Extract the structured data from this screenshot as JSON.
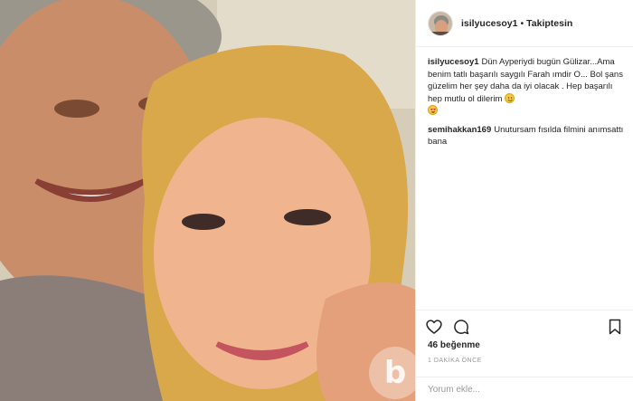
{
  "post": {
    "username": "isilyucesoy1",
    "separator": "•",
    "follow_status": "Takiptesin"
  },
  "comments": [
    {
      "username": "isilyucesoy1",
      "text": "Dün Ayperiydi bugün Gülizar...Ama benim tatlı başarılı saygılı Farah ımdir O... Bol şans güzelim her şey daha da iyi olacak . Hep başarılı hep mutlu ol dilerim",
      "emojis": [
        "smiling-face-icon",
        "smiling-face-with-heart-eyes-icon"
      ]
    },
    {
      "username": "semihakkan169",
      "text": "Unutursam fısılda filmini anımsattı bana"
    }
  ],
  "actions": {
    "icons": [
      "heart-icon",
      "comment-icon",
      "bookmark-icon"
    ]
  },
  "likes_text": "46 beğenme",
  "time_text": "1 DAKİKA ÖNCE",
  "comment_input": {
    "placeholder": "Yorum ekle..."
  },
  "watermark_letter": "b",
  "colors": {
    "text": "#262626",
    "secondary_text": "#999999",
    "divider": "#efefef"
  }
}
